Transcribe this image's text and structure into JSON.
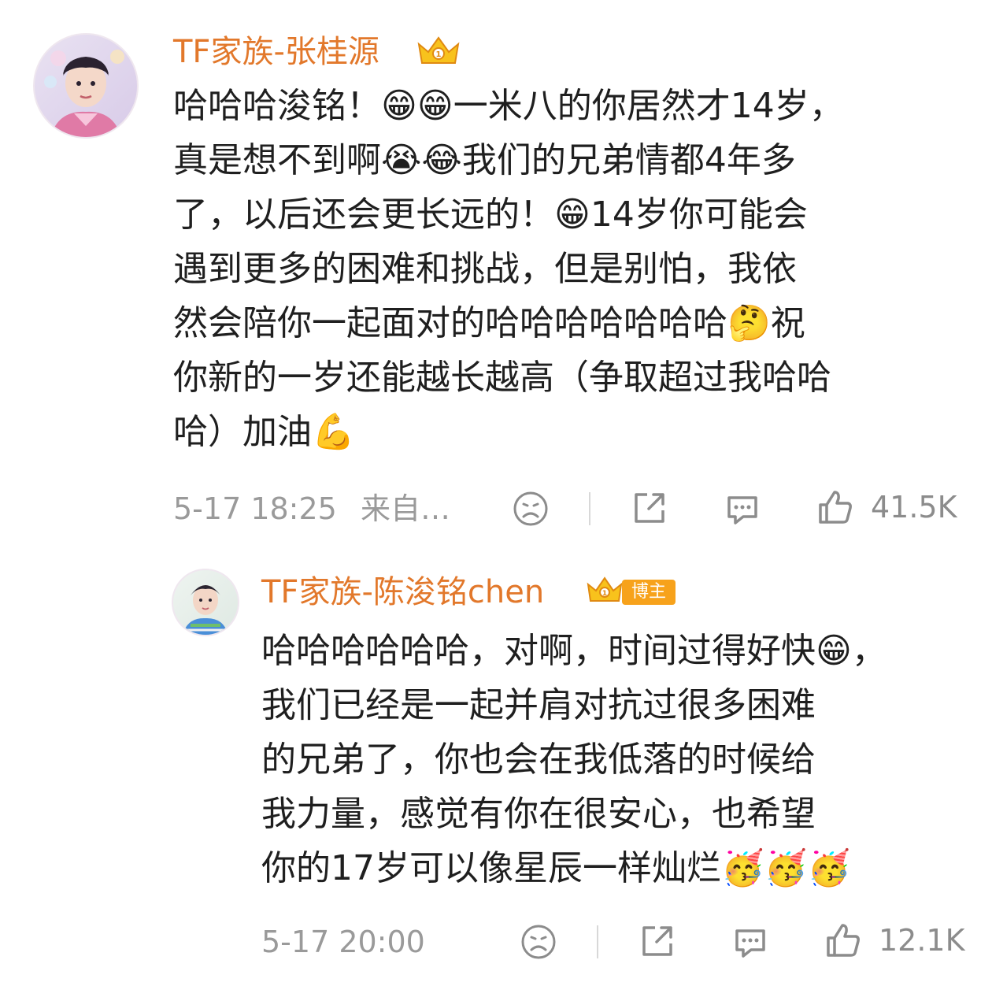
{
  "comments": [
    {
      "username": "TF家族-张桂源",
      "text_lines": [
        "哈哈哈浚铭！😁😁一米八的你居然才14岁，",
        "真是想不到啊😭😂我们的兄弟情都4年多",
        "了，以后还会更长远的！😁14岁你可能会",
        "遇到更多的困难和挑战，但是别怕，我依",
        "然会陪你一起面对的哈哈哈哈哈哈哈🤔祝",
        "你新的一岁还能越长越高（争取超过我哈哈",
        "哈）加油💪"
      ],
      "timestamp": "5-17 18:25",
      "source": "来自…",
      "likes": "41.5K",
      "badge_icon": "crown-badge-icon"
    },
    {
      "username": "TF家族-陈浚铭chen",
      "blogger_tag": "博主",
      "text_lines": [
        "哈哈哈哈哈哈，对啊，时间过得好快😁，",
        "我们已经是一起并肩对抗过很多困难",
        "的兄弟了，你也会在我低落的时候给",
        "我力量，感觉有你在很安心，也希望",
        "你的17岁可以像星辰一样灿烂🥳🥳🥳"
      ],
      "timestamp": "5-17 20:00",
      "likes": "12.1K",
      "badge_icon": "crown-badge-icon"
    }
  ],
  "colors": {
    "username": "#e2782b",
    "meta": "#9a9a9a",
    "body": "#1f1f1f",
    "blogger_tag_bg": "#f7a21b"
  }
}
